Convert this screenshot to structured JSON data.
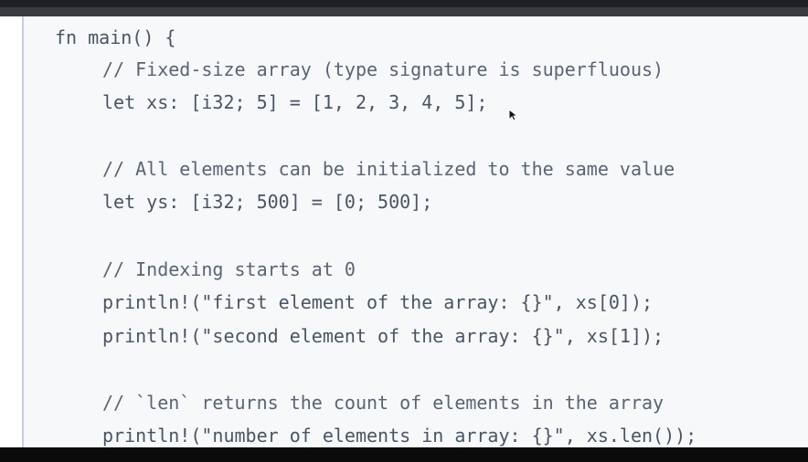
{
  "editor": {
    "lines": [
      "fn main() {",
      "// Fixed-size array (type signature is superfluous)",
      "let xs: [i32; 5] = [1, 2, 3, 4, 5];",
      "// All elements can be initialized to the same value",
      "let ys: [i32; 500] = [0; 500];",
      "// Indexing starts at 0",
      "println!(\"first element of the array: {}\", xs[0]);",
      "println!(\"second element of the array: {}\", xs[1]);",
      "// `len` returns the count of elements in the array",
      "println!(\"number of elements in array: {}\", xs.len());"
    ]
  },
  "cursor": {
    "icon": "mouse-pointer-icon"
  },
  "colors": {
    "background": "#f6f8fa",
    "text": "#4a5563",
    "top_bar": "#3a3c40",
    "gutter_border": "#c9cfd8",
    "bottom_bar": "#0b0b0c"
  }
}
